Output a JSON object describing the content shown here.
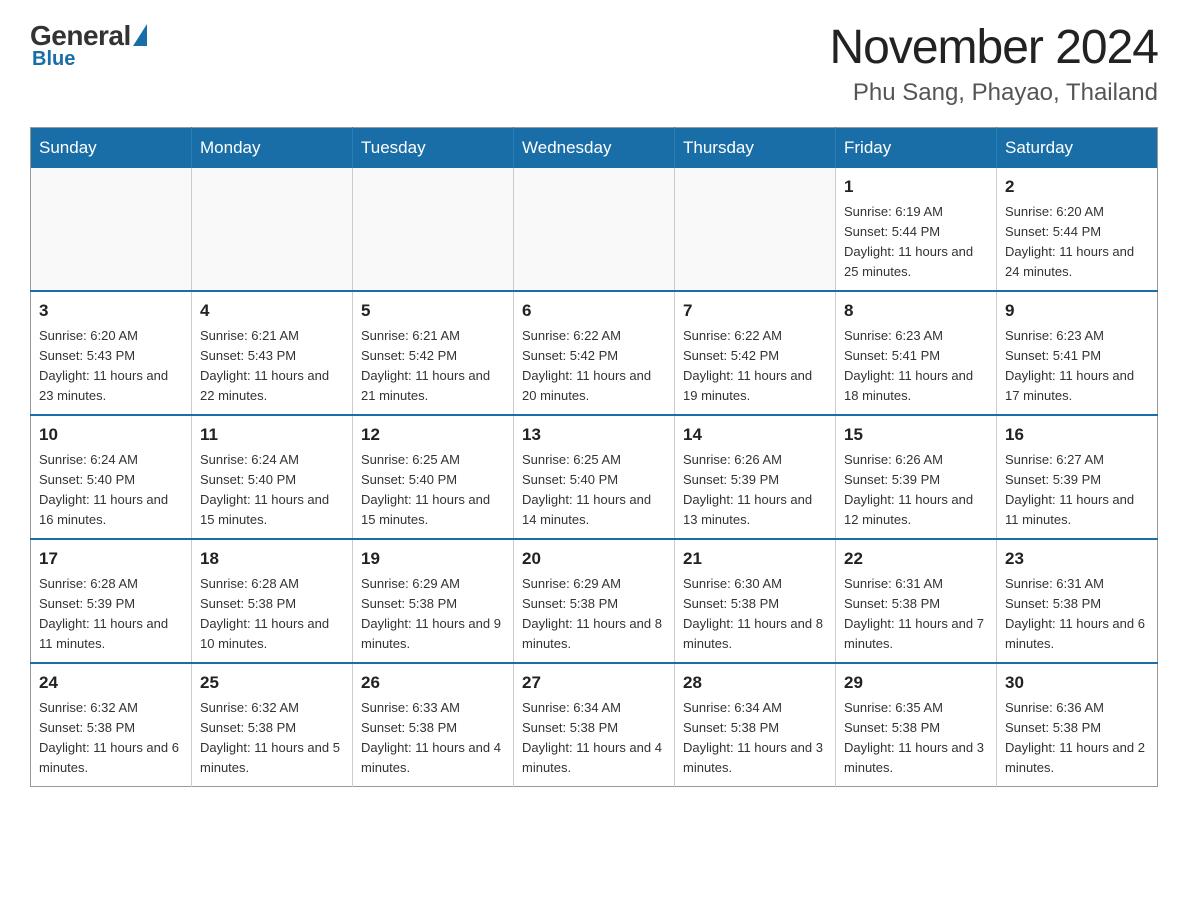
{
  "header": {
    "logo": {
      "general": "General",
      "blue": "Blue"
    },
    "month_title": "November 2024",
    "location": "Phu Sang, Phayao, Thailand"
  },
  "days_of_week": [
    "Sunday",
    "Monday",
    "Tuesday",
    "Wednesday",
    "Thursday",
    "Friday",
    "Saturday"
  ],
  "weeks": [
    [
      {
        "day": "",
        "info": ""
      },
      {
        "day": "",
        "info": ""
      },
      {
        "day": "",
        "info": ""
      },
      {
        "day": "",
        "info": ""
      },
      {
        "day": "",
        "info": ""
      },
      {
        "day": "1",
        "info": "Sunrise: 6:19 AM\nSunset: 5:44 PM\nDaylight: 11 hours and 25 minutes."
      },
      {
        "day": "2",
        "info": "Sunrise: 6:20 AM\nSunset: 5:44 PM\nDaylight: 11 hours and 24 minutes."
      }
    ],
    [
      {
        "day": "3",
        "info": "Sunrise: 6:20 AM\nSunset: 5:43 PM\nDaylight: 11 hours and 23 minutes."
      },
      {
        "day": "4",
        "info": "Sunrise: 6:21 AM\nSunset: 5:43 PM\nDaylight: 11 hours and 22 minutes."
      },
      {
        "day": "5",
        "info": "Sunrise: 6:21 AM\nSunset: 5:42 PM\nDaylight: 11 hours and 21 minutes."
      },
      {
        "day": "6",
        "info": "Sunrise: 6:22 AM\nSunset: 5:42 PM\nDaylight: 11 hours and 20 minutes."
      },
      {
        "day": "7",
        "info": "Sunrise: 6:22 AM\nSunset: 5:42 PM\nDaylight: 11 hours and 19 minutes."
      },
      {
        "day": "8",
        "info": "Sunrise: 6:23 AM\nSunset: 5:41 PM\nDaylight: 11 hours and 18 minutes."
      },
      {
        "day": "9",
        "info": "Sunrise: 6:23 AM\nSunset: 5:41 PM\nDaylight: 11 hours and 17 minutes."
      }
    ],
    [
      {
        "day": "10",
        "info": "Sunrise: 6:24 AM\nSunset: 5:40 PM\nDaylight: 11 hours and 16 minutes."
      },
      {
        "day": "11",
        "info": "Sunrise: 6:24 AM\nSunset: 5:40 PM\nDaylight: 11 hours and 15 minutes."
      },
      {
        "day": "12",
        "info": "Sunrise: 6:25 AM\nSunset: 5:40 PM\nDaylight: 11 hours and 15 minutes."
      },
      {
        "day": "13",
        "info": "Sunrise: 6:25 AM\nSunset: 5:40 PM\nDaylight: 11 hours and 14 minutes."
      },
      {
        "day": "14",
        "info": "Sunrise: 6:26 AM\nSunset: 5:39 PM\nDaylight: 11 hours and 13 minutes."
      },
      {
        "day": "15",
        "info": "Sunrise: 6:26 AM\nSunset: 5:39 PM\nDaylight: 11 hours and 12 minutes."
      },
      {
        "day": "16",
        "info": "Sunrise: 6:27 AM\nSunset: 5:39 PM\nDaylight: 11 hours and 11 minutes."
      }
    ],
    [
      {
        "day": "17",
        "info": "Sunrise: 6:28 AM\nSunset: 5:39 PM\nDaylight: 11 hours and 11 minutes."
      },
      {
        "day": "18",
        "info": "Sunrise: 6:28 AM\nSunset: 5:38 PM\nDaylight: 11 hours and 10 minutes."
      },
      {
        "day": "19",
        "info": "Sunrise: 6:29 AM\nSunset: 5:38 PM\nDaylight: 11 hours and 9 minutes."
      },
      {
        "day": "20",
        "info": "Sunrise: 6:29 AM\nSunset: 5:38 PM\nDaylight: 11 hours and 8 minutes."
      },
      {
        "day": "21",
        "info": "Sunrise: 6:30 AM\nSunset: 5:38 PM\nDaylight: 11 hours and 8 minutes."
      },
      {
        "day": "22",
        "info": "Sunrise: 6:31 AM\nSunset: 5:38 PM\nDaylight: 11 hours and 7 minutes."
      },
      {
        "day": "23",
        "info": "Sunrise: 6:31 AM\nSunset: 5:38 PM\nDaylight: 11 hours and 6 minutes."
      }
    ],
    [
      {
        "day": "24",
        "info": "Sunrise: 6:32 AM\nSunset: 5:38 PM\nDaylight: 11 hours and 6 minutes."
      },
      {
        "day": "25",
        "info": "Sunrise: 6:32 AM\nSunset: 5:38 PM\nDaylight: 11 hours and 5 minutes."
      },
      {
        "day": "26",
        "info": "Sunrise: 6:33 AM\nSunset: 5:38 PM\nDaylight: 11 hours and 4 minutes."
      },
      {
        "day": "27",
        "info": "Sunrise: 6:34 AM\nSunset: 5:38 PM\nDaylight: 11 hours and 4 minutes."
      },
      {
        "day": "28",
        "info": "Sunrise: 6:34 AM\nSunset: 5:38 PM\nDaylight: 11 hours and 3 minutes."
      },
      {
        "day": "29",
        "info": "Sunrise: 6:35 AM\nSunset: 5:38 PM\nDaylight: 11 hours and 3 minutes."
      },
      {
        "day": "30",
        "info": "Sunrise: 6:36 AM\nSunset: 5:38 PM\nDaylight: 11 hours and 2 minutes."
      }
    ]
  ]
}
